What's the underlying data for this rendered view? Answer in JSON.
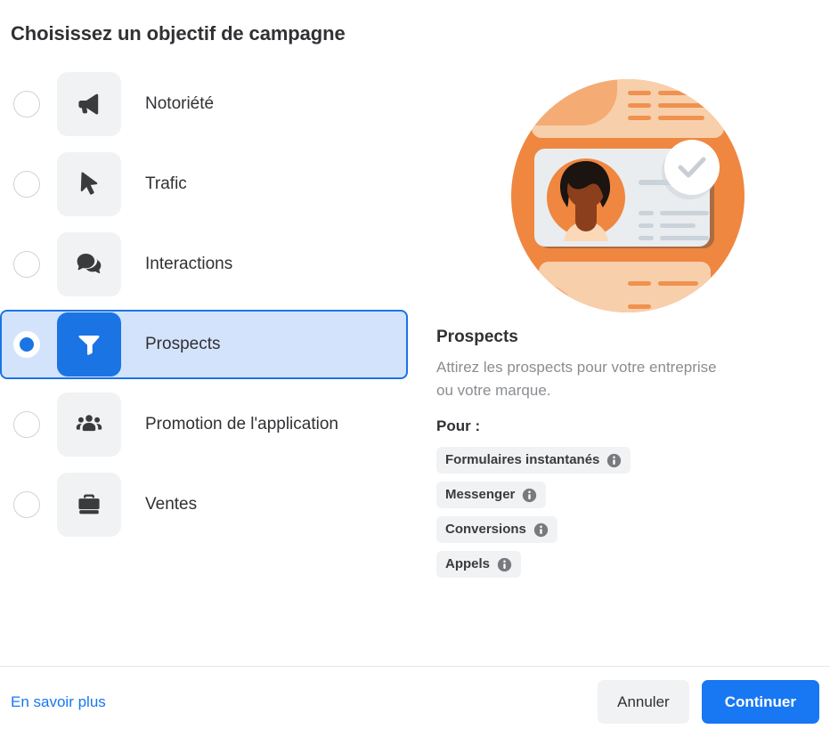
{
  "page": {
    "title": "Choisissez un objectif de campagne"
  },
  "objectives": [
    {
      "id": "awareness",
      "label": "Notoriété",
      "icon": "megaphone-icon",
      "selected": false
    },
    {
      "id": "traffic",
      "label": "Trafic",
      "icon": "cursor-icon",
      "selected": false
    },
    {
      "id": "engagement",
      "label": "Interactions",
      "icon": "chat-bubbles-icon",
      "selected": false
    },
    {
      "id": "leads",
      "label": "Prospects",
      "icon": "funnel-icon",
      "selected": true
    },
    {
      "id": "app",
      "label": "Promotion de l'application",
      "icon": "people-group-icon",
      "selected": false
    },
    {
      "id": "sales",
      "label": "Ventes",
      "icon": "briefcase-icon",
      "selected": false
    }
  ],
  "detail": {
    "illustration_alt": "leads-illustration",
    "title": "Prospects",
    "description": "Attirez les prospects pour votre entreprise ou votre marque.",
    "for_label": "Pour :",
    "chips": [
      {
        "label": "Formulaires instantanés",
        "info": "info-icon"
      },
      {
        "label": "Messenger",
        "info": "info-icon"
      },
      {
        "label": "Conversions",
        "info": "info-icon"
      },
      {
        "label": "Appels",
        "info": "info-icon"
      }
    ]
  },
  "footer": {
    "learn_more": "En savoir plus",
    "cancel": "Annuler",
    "continue": "Continuer"
  },
  "colors": {
    "accent_blue": "#1877f2",
    "selected_border": "#1b74e4",
    "selected_fill": "#d4e3fc",
    "tile_gray": "#f1f2f3",
    "text_primary": "#303134",
    "text_muted": "#8a8d91",
    "illustration_orange": "#ef8740",
    "illustration_peach": "#f6c9a4"
  }
}
